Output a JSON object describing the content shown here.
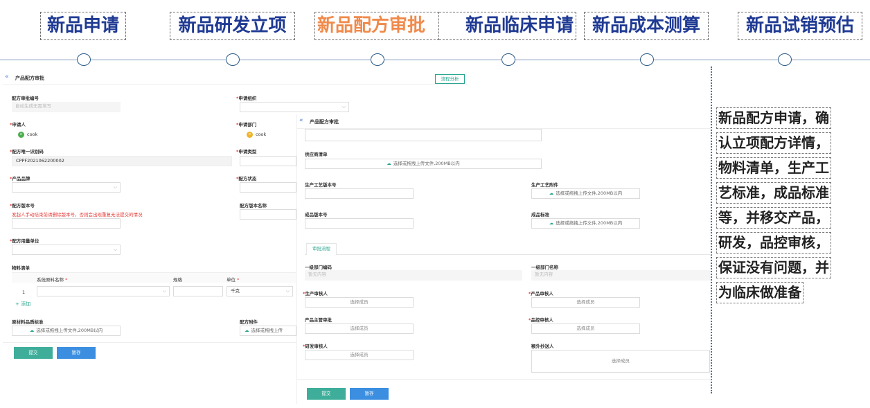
{
  "steps": [
    {
      "label": "新品申请"
    },
    {
      "label": "新品研发立项"
    },
    {
      "label": "新品配方审批"
    },
    {
      "label": "新品临床申请"
    },
    {
      "label": "新品成本测算"
    },
    {
      "label": "新品试销预估"
    }
  ],
  "description": [
    "新品配方申请，确",
    "认立项配方详情，",
    "物料清单，生产工",
    "艺标准，成品标准",
    "等，并移交产品，",
    "研发，品控审核，",
    "保证没有问题，并",
    "为临床做准备"
  ],
  "colors": {
    "title": "#1f3a93",
    "active": "#f08a4b",
    "primary_green": "#3eae9a",
    "primary_blue": "#3c8fe0",
    "required": "#e53935"
  },
  "panel1": {
    "back_icon": "double-chevron-left-icon",
    "title": "产品配方审批",
    "flow_btn": "流程分析",
    "recipe_no_label": "配方审批编号",
    "recipe_no_placeholder": "自动生成无需填写",
    "org_label": "申请组织",
    "applicant_label": "申请人",
    "applicant_initial": "c",
    "applicant_name": "cook",
    "dept_label": "申请部门",
    "dept_initial": "c",
    "dept_name": "cook",
    "code_label": "配方唯一识别码",
    "code_value": "CPPF2021062200002",
    "type_label": "申请类型",
    "brand_label": "产品品牌",
    "status_label": "配方状态",
    "version_label": "配方版本号",
    "version_warning": "发起人手动结束前请删除版本号，否则会出现重复无法提交的情况",
    "version_name_label": "配方版本名称",
    "unit_label": "配方用量单位",
    "bom_title": "物料清单",
    "col_name": "系统原料名称",
    "col_spec": "规格",
    "col_unit": "单位",
    "row_index": "1",
    "row_unit": "千克",
    "add_label": "+ 添加",
    "quality_label": "原材料品质标准",
    "quality_upload": "选择或拖拽上传文件,200MB以内",
    "attach_label": "配方附件",
    "attach_upload": "选择或拖拽上传",
    "submit": "提交",
    "save": "暂存"
  },
  "panel2": {
    "back_icon": "double-chevron-left-icon",
    "title": "产品配方审批",
    "supplier_label": "供应商清单",
    "supplier_upload": "选择或拖拽上传文件,200MB以内",
    "process_ver_label": "生产工艺版本号",
    "process_attach_label": "生产工艺附件",
    "process_attach_upload": "选择或拖拽上传文件,200MB以内",
    "product_ver_label": "成品版本号",
    "product_std_label": "成品标准",
    "product_std_upload": "选择或拖拽上传文件,200MB以内",
    "tab_label": "审批流程",
    "dept1_code_label": "一级部门编码",
    "dept1_code_placeholder": "暂无内容",
    "dept1_name_label": "一级部门名称",
    "dept1_name_placeholder": "暂无内容",
    "prod_reviewer_label": "生产审核人",
    "product_reviewer_label": "产品审核人",
    "prod_manager_label": "产品主管审批",
    "qc_reviewer_label": "品控审核人",
    "rd_reviewer_label": "研发审核人",
    "cc_label": "额外抄送人",
    "select_member": "选择成员",
    "submit": "提交",
    "save": "暂存"
  }
}
